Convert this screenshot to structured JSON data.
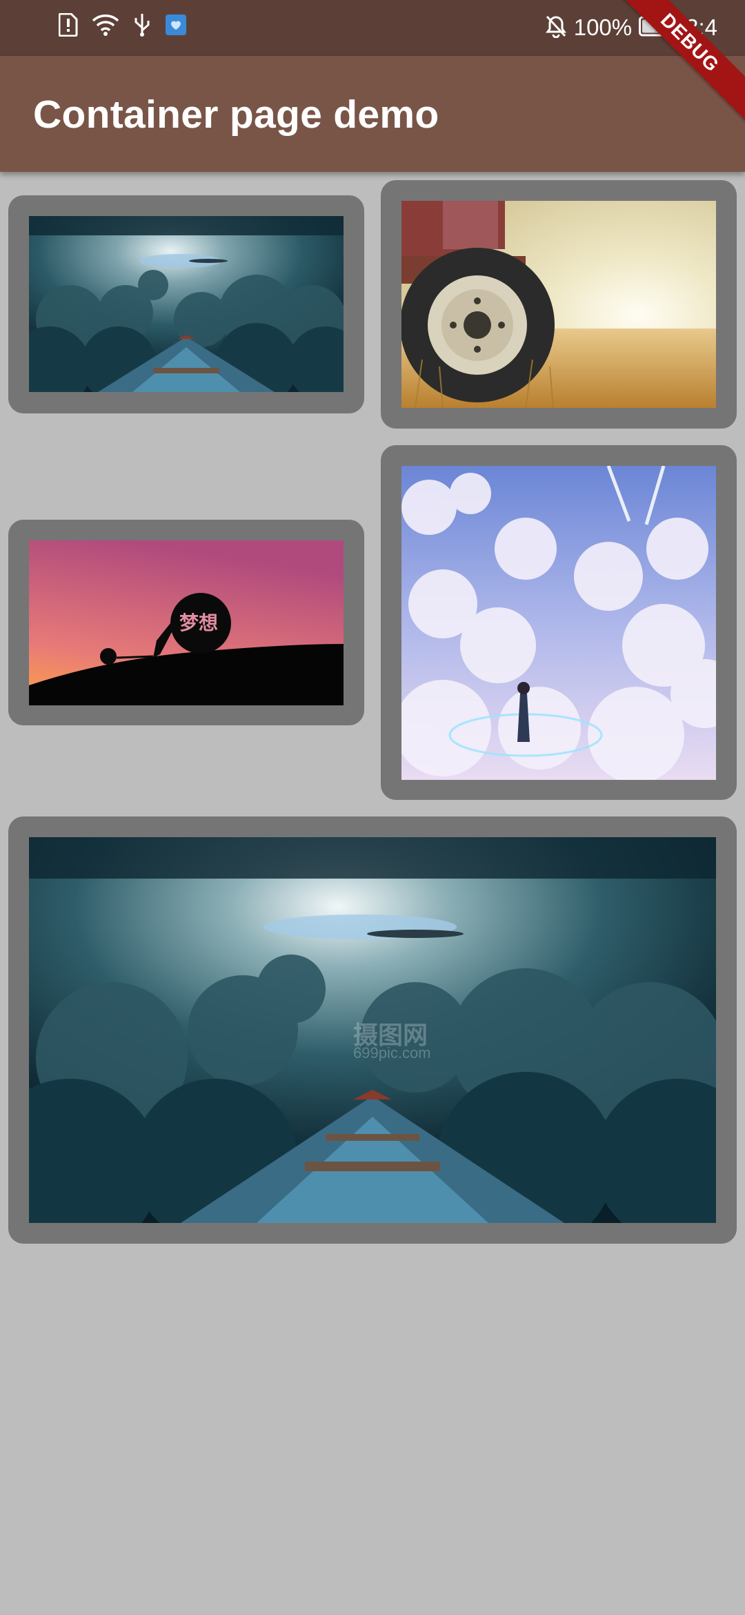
{
  "status_bar": {
    "battery_percent": "100%",
    "time": "3:4",
    "icons": [
      "alert-sim-icon",
      "wifi-icon",
      "usb-icon",
      "app-notification-icon",
      "bell-off-icon",
      "battery-charging-icon"
    ]
  },
  "app_bar": {
    "title": "Container page demo"
  },
  "debug_banner": {
    "label": "DEBUG"
  },
  "images": {
    "dream_caption": "梦想",
    "watermark_text": "摄图网",
    "watermark_url": "699pic.com"
  },
  "colors": {
    "status_bar": "#5c4037",
    "app_bar": "#795548",
    "background": "#bdbdbd",
    "card": "#757575",
    "debug_banner": "#a31515"
  }
}
